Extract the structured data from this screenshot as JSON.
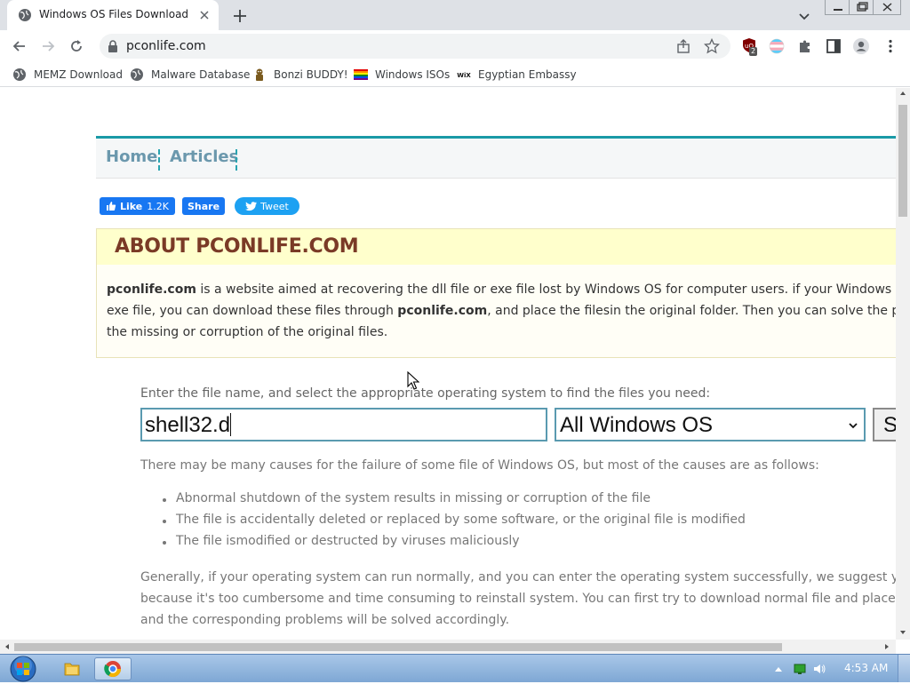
{
  "browser": {
    "tab_title": "Windows OS Files Download",
    "url": "pconlife.com",
    "extension_badge": "2"
  },
  "bookmarks": [
    {
      "label": "MEMZ Download",
      "icon": "globe-icon"
    },
    {
      "label": "Malware Database",
      "icon": "globe-icon"
    },
    {
      "label": "Bonzi BUDDY!",
      "icon": "bonzi-icon"
    },
    {
      "label": "Windows ISOs",
      "icon": "rainbow-flag-icon"
    },
    {
      "label": "Egyptian Embassy",
      "icon": "wix-icon"
    }
  ],
  "site": {
    "nav": [
      "Home",
      "Articles"
    ],
    "social": {
      "like": "Like",
      "like_count": "1.2K",
      "share": "Share",
      "tweet": "Tweet"
    },
    "about": {
      "heading": "ABOUT PCONLIFE.COM",
      "brand": "pconlife.com",
      "line1_rest": " is a website aimed at recovering the dll file or exe file lost by Windows OS for computer users. if your Windows OS lost",
      "line2_a": "exe file, you can download these files through ",
      "line2_brand": "pconlife.com",
      "line2_b": ", and place the filesin the original folder. Then you can solve the problem",
      "line3": "the missing or corruption of the original files."
    },
    "search": {
      "hint": "Enter the file name, and select the appropriate operating system to find the files you need:",
      "filename_value": "shell32.d",
      "os_value": "All Windows OS",
      "button_label": "S"
    },
    "causes_intro": "There may be many causes for the failure of some file of Windows OS, but most of the causes are as follows:",
    "causes": [
      "Abnormal shutdown of the system results in missing or corruption of the file",
      "The file is accidentally deleted or replaced by some software, or the original file is modified",
      "The file ismodified or destructed by viruses maliciously"
    ],
    "advice": [
      "Generally, if your operating system can run normally, and you can enter the operating system successfully, we suggest you do not rein",
      "because it's too cumbersome and time consuming to reinstall system. You can first try to download normal file and place it back into t",
      "and the corresponding problems will be solved accordingly."
    ]
  },
  "taskbar": {
    "clock": "4:53 AM"
  },
  "colors": {
    "accent": "#1a9aa6",
    "about_heading": "#7a3a26",
    "facebook": "#1877f2",
    "twitter": "#1da1f2"
  }
}
